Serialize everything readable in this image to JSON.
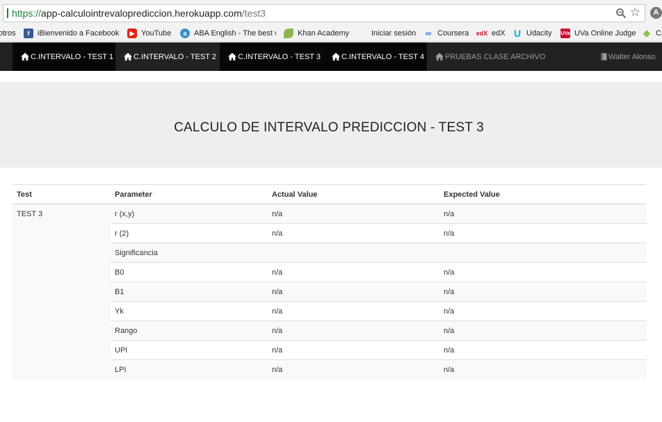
{
  "browser": {
    "url_scheme": "https://",
    "url_host": "app-calculointrevalopred iccion.herokuapp.com",
    "url_path": "/test3"
  },
  "bookmarks": [
    {
      "label": "otros",
      "icon": "folder-icon",
      "color": "#999999"
    },
    {
      "label": "iBienvenido a Facebook",
      "icon": "facebook-icon",
      "color": "#3b5998"
    },
    {
      "label": "YouTube",
      "icon": "youtube-icon",
      "color": "#e62117"
    },
    {
      "label": "ABA English - The best w",
      "icon": "aba-english-icon",
      "color": "#3a8fc4"
    },
    {
      "label": "Khan Academy",
      "icon": "khan-academy-icon",
      "color": "#8bb64f"
    },
    {
      "label": "Iniciar sesión",
      "icon": "microsoft-icon",
      "color": "#f25022"
    },
    {
      "label": "Coursera",
      "icon": "coursera-icon",
      "color": "#2a73cc"
    },
    {
      "label": "edX",
      "icon": "edx-icon",
      "color": "#c8102e"
    },
    {
      "label": "Udacity",
      "icon": "udacity-icon",
      "color": "#02b3e4"
    },
    {
      "label": "UVa Online Judge",
      "icon": "uva-icon",
      "color": "#c8102e"
    },
    {
      "label": "Ca",
      "icon": "leaf-icon",
      "color": "#8bc34a"
    }
  ],
  "navbar": {
    "items": [
      {
        "label": "C.INTERVALO - TEST 1"
      },
      {
        "label": "C.INTERVALO - TEST 2"
      },
      {
        "label": "C.INTERVALO - TEST 3"
      },
      {
        "label": "C.INTERVALO - TEST 4"
      },
      {
        "label": "PRUEBAS CLASE ARCHIVO"
      }
    ],
    "user": "Walter Alonso"
  },
  "page": {
    "title": "CALCULO DE INTERVALO PREDICCION - TEST 3"
  },
  "table": {
    "headers": [
      "Test",
      "Parameter",
      "Actual Value",
      "Expected Value"
    ],
    "test_name": "TEST 3",
    "rows": [
      {
        "parameter": "r (x,y)",
        "actual": "n/a",
        "expected": "n/a"
      },
      {
        "parameter": "r (2)",
        "actual": "n/a",
        "expected": "n/a"
      },
      {
        "parameter": "Significancia",
        "actual": "",
        "expected": ""
      },
      {
        "parameter": "B0",
        "actual": "n/a",
        "expected": "n/a"
      },
      {
        "parameter": "B1",
        "actual": "n/a",
        "expected": "n/a"
      },
      {
        "parameter": "Yk",
        "actual": "n/a",
        "expected": "n/a"
      },
      {
        "parameter": "Rango",
        "actual": "n/a",
        "expected": "n/a"
      },
      {
        "parameter": "UPI",
        "actual": "n/a",
        "expected": "n/a"
      },
      {
        "parameter": "LPI",
        "actual": "n/a",
        "expected": "n/a"
      }
    ]
  }
}
